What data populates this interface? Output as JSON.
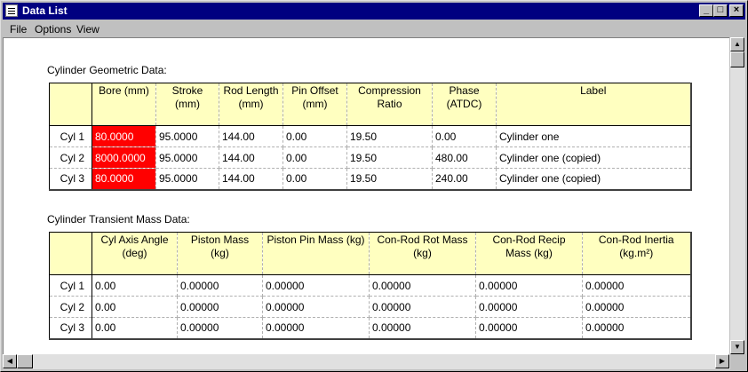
{
  "window": {
    "title": "Data List"
  },
  "menu": [
    "File",
    "Options",
    "View"
  ],
  "geometric": {
    "title": "Cylinder Geometric Data:",
    "columns": [
      "Bore (mm)",
      "Stroke (mm)",
      "Rod Length (mm)",
      "Pin Offset (mm)",
      "Compression Ratio",
      "Phase (ATDC)",
      "Label"
    ],
    "rows": [
      {
        "name": "Cyl 1",
        "cells": [
          "80.0000",
          "95.0000",
          "144.00",
          "0.00",
          "19.50",
          "0.00",
          "Cylinder one"
        ]
      },
      {
        "name": "Cyl 2",
        "cells": [
          "8000.0000",
          "95.0000",
          "144.00",
          "0.00",
          "19.50",
          "480.00",
          "Cylinder one (copied)"
        ]
      },
      {
        "name": "Cyl 3",
        "cells": [
          "80.0000",
          "95.0000",
          "144.00",
          "0.00",
          "19.50",
          "240.00",
          "Cylinder one (copied)"
        ]
      }
    ],
    "highlight_color": "#ff0000"
  },
  "mass": {
    "title": "Cylinder Transient Mass Data:",
    "columns": [
      "Cyl Axis Angle (deg)",
      "Piston Mass (kg)",
      "Piston Pin Mass (kg)",
      "Con-Rod Rot Mass (kg)",
      "Con-Rod Recip Mass (kg)",
      "Con-Rod Inertia (kg.m²)"
    ],
    "rows": [
      {
        "name": "Cyl 1",
        "cells": [
          "0.00",
          "0.00000",
          "0.00000",
          "0.00000",
          "0.00000",
          "0.00000"
        ]
      },
      {
        "name": "Cyl 2",
        "cells": [
          "0.00",
          "0.00000",
          "0.00000",
          "0.00000",
          "0.00000",
          "0.00000"
        ]
      },
      {
        "name": "Cyl 3",
        "cells": [
          "0.00",
          "0.00000",
          "0.00000",
          "0.00000",
          "0.00000",
          "0.00000"
        ]
      }
    ]
  },
  "colors": {
    "title_bar": "#000080",
    "header_bg": "#ffffc0",
    "invalid_cell": "#ff0000"
  }
}
